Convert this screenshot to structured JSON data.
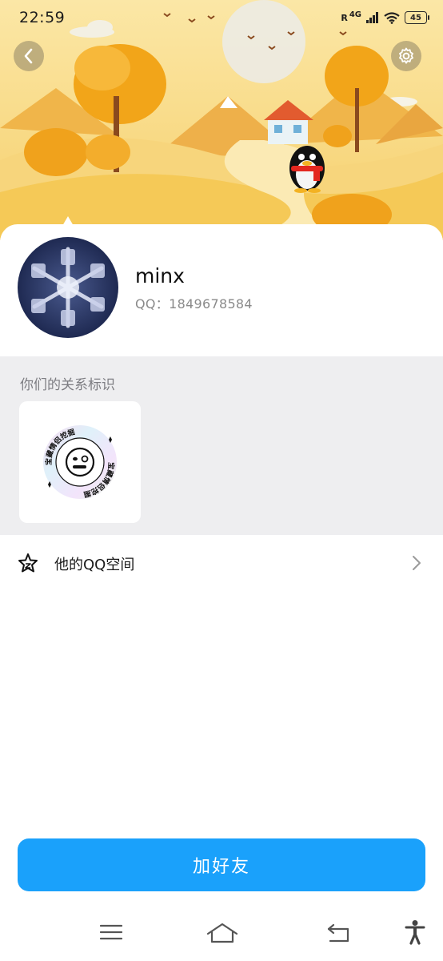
{
  "status_bar": {
    "time": "22:59",
    "roaming": "R",
    "network": "4G",
    "battery": "45"
  },
  "header": {
    "back_icon": "chevron-left-icon",
    "settings_icon": "gear-icon"
  },
  "profile": {
    "nickname": "minx",
    "qq_number": "QQ：1849678584"
  },
  "relation": {
    "title": "你们的关系标识",
    "badge_text": "宝藏情侣挖掘"
  },
  "qzone": {
    "label": "他的QQ空间",
    "icon": "star-icon"
  },
  "actions": {
    "add_friend_label": "加好友"
  },
  "nav": {
    "menu_icon": "menu-icon",
    "home_icon": "home-icon",
    "back_icon": "return-icon",
    "accessibility_icon": "accessibility-icon"
  },
  "colors": {
    "accent": "#1aa1fb",
    "section_bg": "#eeeef0",
    "banner_sky": "#fbe7a6"
  }
}
